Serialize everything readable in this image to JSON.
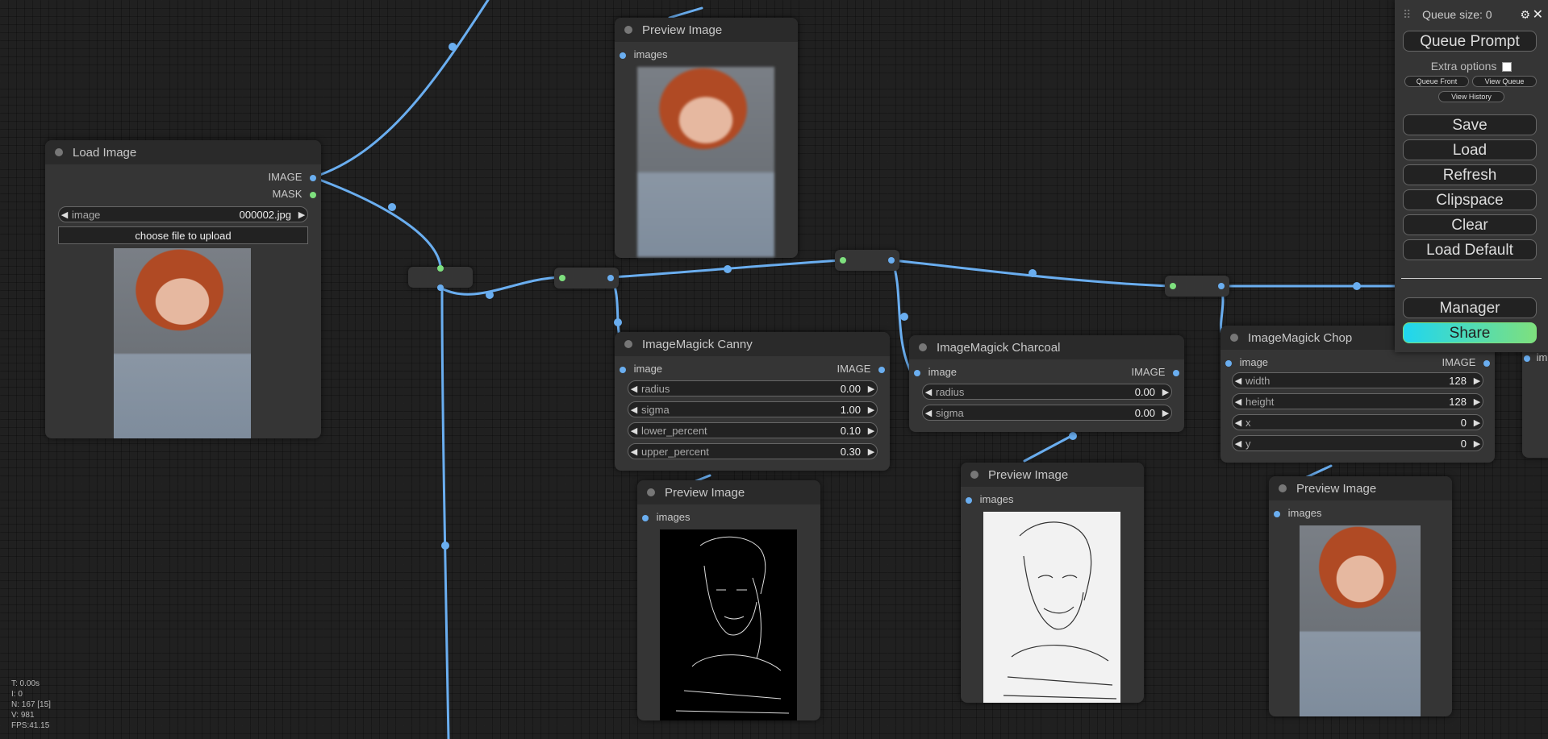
{
  "nodes": {
    "load_image": {
      "title": "Load Image",
      "outputs": [
        "IMAGE",
        "MASK"
      ],
      "image_label": "image",
      "image_value": "000002.jpg",
      "upload_label": "choose file to upload"
    },
    "preview_top": {
      "title": "Preview Image",
      "input": "images"
    },
    "canny": {
      "title": "ImageMagick Canny",
      "input": "image",
      "output": "IMAGE",
      "widgets": [
        {
          "label": "radius",
          "value": "0.00"
        },
        {
          "label": "sigma",
          "value": "1.00"
        },
        {
          "label": "lower_percent",
          "value": "0.10"
        },
        {
          "label": "upper_percent",
          "value": "0.30"
        }
      ]
    },
    "charcoal": {
      "title": "ImageMagick Charcoal",
      "input": "image",
      "output": "IMAGE",
      "widgets": [
        {
          "label": "radius",
          "value": "0.00"
        },
        {
          "label": "sigma",
          "value": "0.00"
        }
      ]
    },
    "chop": {
      "title": "ImageMagick Chop",
      "input": "image",
      "output": "IMAGE",
      "widgets": [
        {
          "label": "width",
          "value": "128"
        },
        {
          "label": "height",
          "value": "128"
        },
        {
          "label": "x",
          "value": "0"
        },
        {
          "label": "y",
          "value": "0"
        }
      ]
    },
    "preview_canny": {
      "title": "Preview Image",
      "input": "images"
    },
    "preview_charcoal": {
      "title": "Preview Image",
      "input": "images"
    },
    "preview_chop": {
      "title": "Preview Image",
      "input": "images"
    },
    "partial_right": {
      "input_prefix": "im"
    }
  },
  "menu": {
    "queue_size": "Queue size: 0",
    "queue_prompt": "Queue Prompt",
    "extra_options": "Extra options",
    "queue_front": "Queue Front",
    "view_queue": "View Queue",
    "view_history": "View History",
    "buttons": [
      "Save",
      "Load",
      "Refresh",
      "Clipspace",
      "Clear",
      "Load Default"
    ],
    "manager": "Manager",
    "share": "Share",
    "gear_icon": "gear-icon",
    "close_icon": "close-icon"
  },
  "stats": [
    "T: 0.00s",
    "I: 0",
    "N: 167 [15]",
    "V: 981",
    "FPS:41.15"
  ],
  "colors": {
    "link": "#6aaef0",
    "node_bg": "#353535",
    "title_bg": "#2a2a2a",
    "share_gradient_start": "#1fd6f0",
    "share_gradient_end": "#7ee07e"
  }
}
